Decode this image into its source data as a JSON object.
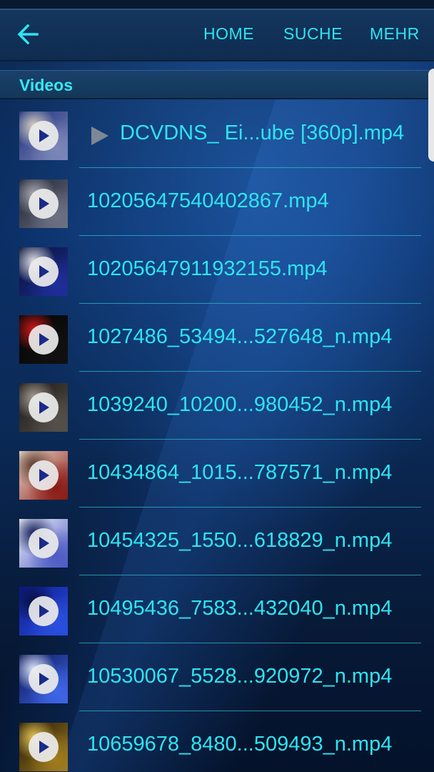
{
  "actionbar": {
    "menu": [
      "HOME",
      "SUCHE",
      "MEHR"
    ]
  },
  "section": {
    "title": "Videos"
  },
  "colors": {
    "accent": "#2ee4f0",
    "divider": "#2fb7c9",
    "bar": "#14365e"
  },
  "items": [
    {
      "label": "DCVDNS_ Ei...ube [360p].mp4",
      "playing": true,
      "thumb": [
        "#1b2d7a",
        "#7d87b8",
        "#d9d2c1"
      ]
    },
    {
      "label": "10205647540402867.mp4",
      "playing": false,
      "thumb": [
        "#1b1f2e",
        "#6c7284",
        "#a7a9b2"
      ]
    },
    {
      "label": "10205647911932155.mp4",
      "playing": false,
      "thumb": [
        "#07102e",
        "#1e2e9a",
        "#e4e4ea"
      ]
    },
    {
      "label": "1027486_53494...527648_n.mp4",
      "playing": false,
      "thumb": [
        "#050505",
        "#111111",
        "#d01818"
      ]
    },
    {
      "label": "1039240_10200...980452_n.mp4",
      "playing": false,
      "thumb": [
        "#1a1614",
        "#55504a",
        "#a59d93"
      ]
    },
    {
      "label": "10434864_1015...787571_n.mp4",
      "playing": false,
      "thumb": [
        "#eedfd2",
        "#8a1a14",
        "#5a3a2a"
      ]
    },
    {
      "label": "10454325_1550...618829_n.mp4",
      "playing": false,
      "thumb": [
        "#f4f6fb",
        "#4c5ac4",
        "#101b5a"
      ]
    },
    {
      "label": "10495436_7583...432040_n.mp4",
      "playing": false,
      "thumb": [
        "#0d1a8e",
        "#2a4fe0",
        "#06103c"
      ]
    },
    {
      "label": "10530067_5528...920972_n.mp4",
      "playing": false,
      "thumb": [
        "#0a1450",
        "#3e66e8",
        "#dfe8ff"
      ]
    },
    {
      "label": "10659678_8480...509493_n.mp4",
      "playing": false,
      "thumb": [
        "#1c1406",
        "#a07c1e",
        "#e6c552"
      ]
    }
  ]
}
